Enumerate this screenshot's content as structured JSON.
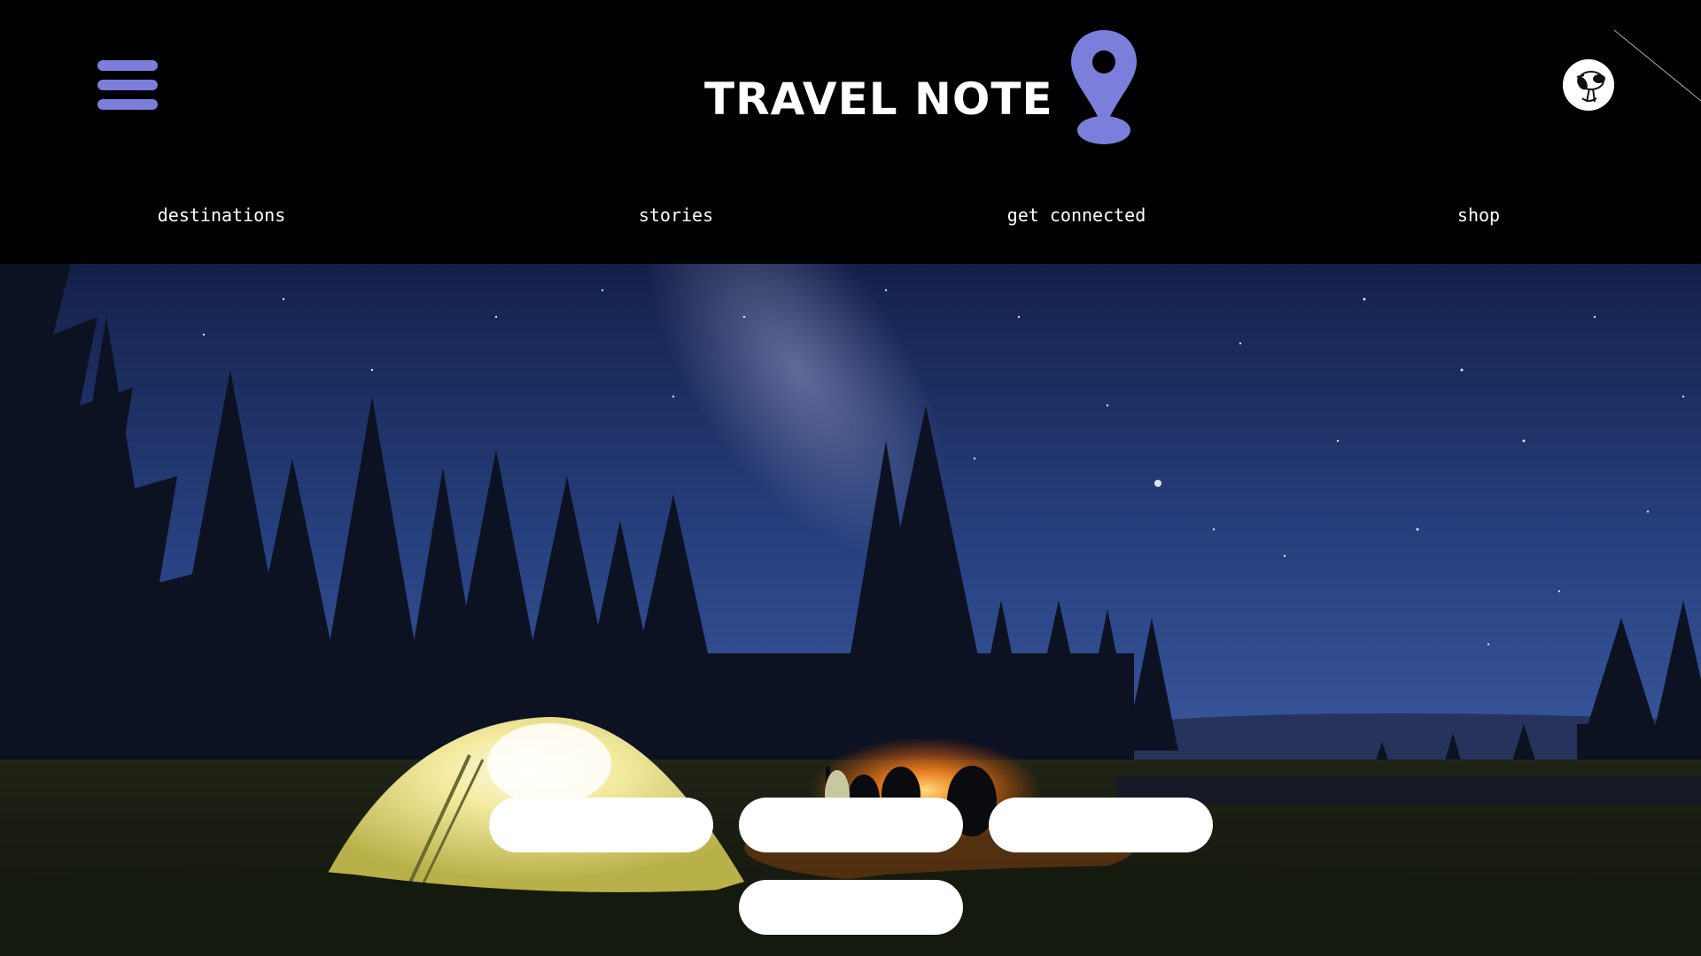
{
  "header": {
    "title": "TRAVEL NOTE",
    "menu_icon": "hamburger-menu-icon",
    "logo_icon": "map-pin-icon",
    "avatar_icon": "user-avatar-icon",
    "accent_color": "#7b7fdb"
  },
  "nav": {
    "items": [
      {
        "label": "destinations"
      },
      {
        "label": "stories"
      },
      {
        "label": "get connected"
      },
      {
        "label": "shop"
      }
    ]
  },
  "hero": {
    "scene": "night-camping-scene",
    "buttons": [
      {
        "label": ""
      },
      {
        "label": ""
      },
      {
        "label": ""
      },
      {
        "label": ""
      }
    ]
  }
}
